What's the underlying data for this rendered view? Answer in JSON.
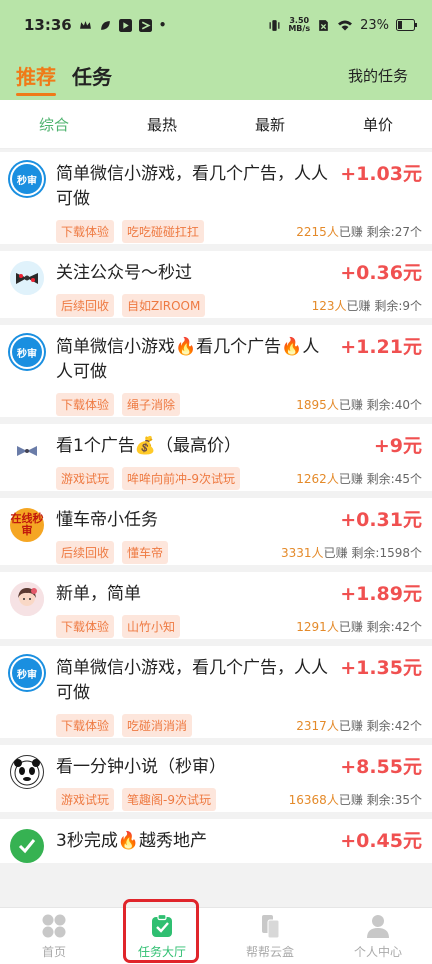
{
  "status": {
    "time": "13:36",
    "speed_value": "3.50",
    "speed_unit": "MB/s",
    "battery": "23%"
  },
  "header": {
    "tab_recommend": "推荐",
    "tab_tasks": "任务",
    "my_tasks": "我的任务"
  },
  "filters": [
    "综合",
    "最热",
    "最新",
    "单价"
  ],
  "tasks": [
    {
      "avatar": "秒审",
      "title": "简单微信小游戏，看几个广告，人人可做",
      "price": "+1.03元",
      "tags": [
        "下载体验",
        "吃吃碰碰扛扛"
      ],
      "earned": "2215人",
      "earned_label": "已赚",
      "remaining": "剩余:27个"
    },
    {
      "avatar": "",
      "title": "关注公众号～秒过",
      "price": "+0.36元",
      "tags": [
        "后续回收",
        "自如ZIROOM"
      ],
      "earned": "123人",
      "earned_label": "已赚",
      "remaining": "剩余:9个"
    },
    {
      "avatar": "秒审",
      "title": "简单微信小游戏🔥看几个广告🔥人人可做",
      "price": "+1.21元",
      "tags": [
        "下载体验",
        "绳子消除"
      ],
      "earned": "1895人",
      "earned_label": "已赚",
      "remaining": "剩余:40个"
    },
    {
      "avatar": "",
      "title": "看1个广告💰（最高价）",
      "price": "+9元",
      "tags": [
        "游戏试玩",
        "哞哞向前冲-9次试玩"
      ],
      "earned": "1262人",
      "earned_label": "已赚",
      "remaining": "剩余:45个"
    },
    {
      "avatar": "在线秒审",
      "title": "懂车帝小任务",
      "price": "+0.31元",
      "tags": [
        "后续回收",
        "懂车帝"
      ],
      "earned": "3331人",
      "earned_label": "已赚",
      "remaining": "剩余:1598个"
    },
    {
      "avatar": "",
      "title": "新单，简单",
      "price": "+1.89元",
      "tags": [
        "下载体验",
        "山竹小知"
      ],
      "earned": "1291人",
      "earned_label": "已赚",
      "remaining": "剩余:42个"
    },
    {
      "avatar": "秒审",
      "title": "简单微信小游戏，看几个广告，人人可做",
      "price": "+1.35元",
      "tags": [
        "下载体验",
        "吃碰消消消"
      ],
      "earned": "2317人",
      "earned_label": "已赚",
      "remaining": "剩余:42个"
    },
    {
      "avatar": "",
      "title": "看一分钟小说（秒审）",
      "price": "+8.55元",
      "tags": [
        "游戏试玩",
        "笔趣阁-9次试玩"
      ],
      "earned": "16368人",
      "earned_label": "已赚",
      "remaining": "剩余:35个"
    },
    {
      "avatar": "",
      "title": "3秒完成🔥越秀地产",
      "price": "+0.45元",
      "tags": [],
      "earned": "",
      "earned_label": "",
      "remaining": ""
    }
  ],
  "nav": [
    {
      "label": "首页"
    },
    {
      "label": "任务大厅"
    },
    {
      "label": "帮帮云盒"
    },
    {
      "label": "个人中心"
    }
  ],
  "colors": {
    "header_bg": "#b8e4a8",
    "accent_orange": "#f07a18",
    "price_red": "#f05050",
    "active_green": "#2fbf71",
    "highlight_red": "#e0252b"
  }
}
